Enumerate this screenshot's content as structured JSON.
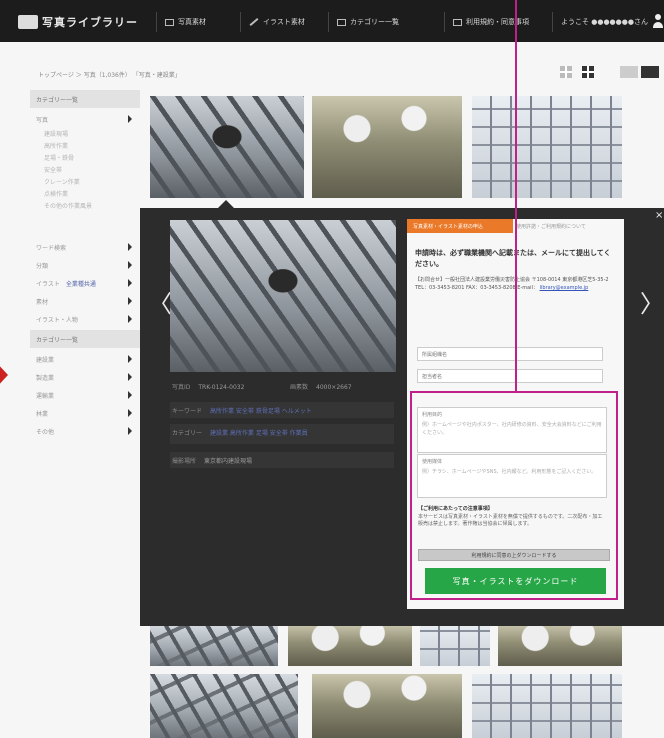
{
  "site": {
    "logo_text": "写真ライブラリー"
  },
  "nav": {
    "items": [
      {
        "label": "写真素材"
      },
      {
        "label": "イラスト素材"
      },
      {
        "label": "カテゴリー一覧"
      },
      {
        "label": "利用規約・同意事項"
      },
      {
        "label": "ようこそ ●●●●●●●さん"
      }
    ]
  },
  "breadcrumb": "トップページ ＞ 写真（1,036件） 「写真・建設業」",
  "sidebar": {
    "items": [
      {
        "label": "カテゴリー一覧",
        "kind": "head"
      },
      {
        "label": "写真",
        "kind": "item"
      },
      {
        "label": "建設現場",
        "kind": "sub"
      },
      {
        "label": "高所作業",
        "kind": "sub"
      },
      {
        "label": "足場・鉄骨",
        "kind": "sub"
      },
      {
        "label": "安全帯",
        "kind": "sub"
      },
      {
        "label": "クレーン作業",
        "kind": "sub"
      },
      {
        "label": "点検作業",
        "kind": "sub"
      },
      {
        "label": "その他の作業風景",
        "kind": "sub"
      },
      {
        "label": "ワード検索",
        "kind": "item"
      },
      {
        "label": "分類",
        "kind": "item"
      },
      {
        "label": "イラスト",
        "kind": "item",
        "tag": "全業種共通"
      },
      {
        "label": "素材",
        "kind": "item"
      },
      {
        "label": "イラスト・人物",
        "kind": "item"
      },
      {
        "label": "カテゴリー一覧",
        "kind": "head"
      },
      {
        "label": "建設業",
        "kind": "item"
      },
      {
        "label": "製造業",
        "kind": "item"
      },
      {
        "label": "運輸業",
        "kind": "item"
      },
      {
        "label": "林業",
        "kind": "item"
      },
      {
        "label": "その他",
        "kind": "item"
      }
    ]
  },
  "modal": {
    "close_glyph": "×",
    "prev_glyph": "〈",
    "next_glyph": "〉",
    "meta": {
      "id_label": "写真ID",
      "id_value": "TRK-0124-0032",
      "size_label": "画素数",
      "size_value": "4000×2667",
      "keywords_label": "キーワード",
      "keywords_value": "高所作業 安全帯 鉄骨足場 ヘルメット",
      "category_label": "カテゴリー",
      "category_value": "建設業 高所作業 足場 安全帯 作業員",
      "credit_label": "撮影場所",
      "credit_value": "東京都内建設現場"
    }
  },
  "panel": {
    "tab_active": "写真素材・イラスト素材の申込",
    "tab_other": "使用許諾・ご利用規約について",
    "title": "申請時は、必ず職業機関へ記載または、メールにて提出してください。",
    "body": "【お問合せ】一般社団法人建設業労働災害防止協会 〒108-0014 東京都港区芝5-35-2 TEL：03-3453-8201 FAX：03-3453-8208 E-mail：",
    "body_link": "library@example.jp",
    "field1": "所属組織名",
    "field2": "担当者名",
    "ta1_label": "利用目的",
    "ta1_text": "例）ホームページや社内ポスター、社内研修の資料、安全大会資料などにご利用ください。",
    "ta2_label": "使用媒体",
    "ta2_text": "例）チラシ、ホームページやSNS、社内報など。利用形態をご記入ください。",
    "notice_title": "【ご利用にあたっての注意事項】",
    "notice_text": "本サービスは写真素材・イラスト素材を無償で提供するものです。二次配布・加工販売は禁止します。著作権は当協会に帰属します。",
    "agree_label": "利用規約に同意の上ダウンロードする",
    "download_label": "写真・イラストをダウンロード"
  }
}
